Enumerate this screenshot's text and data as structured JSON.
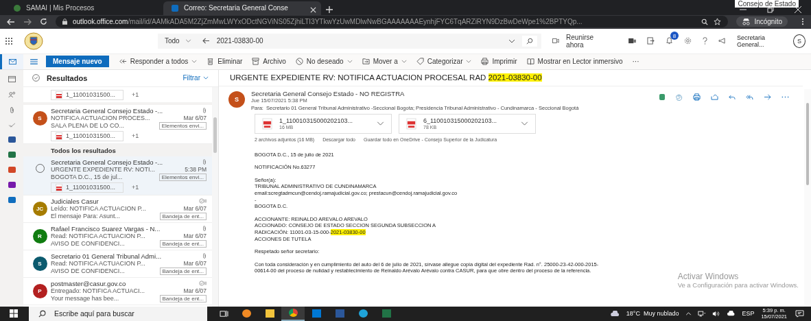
{
  "browser": {
    "overlay_text": "Consejo de Estado",
    "tabs": [
      {
        "title": "SAMAI | Mis Procesos",
        "selected": false
      },
      {
        "title": "Correo: Secretaria General Conse",
        "selected": true
      }
    ],
    "url_host": "outlook.office.com",
    "url_path": "/mail/id/AAMkADA5M2ZjZmMwLWYxODctNGViNS05ZjhiLTI3YTkwYzUwMDlwNwBGAAAAAAAEynhjFYC6TqARZiRYN9DzBwDeWpe1%2BPTYQp...",
    "incognito": "Incógnito"
  },
  "header": {
    "scope": "Todo",
    "search": "2021-03830-00",
    "meet": "Reunirse ahora",
    "badge": "8",
    "account": "Secretaria General...",
    "avatar": "S"
  },
  "commands": [
    {
      "label": "Mensaje nuevo",
      "kind": "primary"
    },
    {
      "label": "Responder a todos",
      "kind": "reply-all"
    },
    {
      "label": "Eliminar",
      "kind": "delete"
    },
    {
      "label": "Archivo",
      "kind": "archive"
    },
    {
      "label": "No deseado",
      "kind": "junk"
    },
    {
      "label": "Mover a",
      "kind": "move"
    },
    {
      "label": "Categorizar",
      "kind": "tag"
    },
    {
      "label": "Imprimir",
      "kind": "print"
    },
    {
      "label": "Mostrar en Lector inmersivo",
      "kind": "reader"
    },
    {
      "label": "···",
      "kind": "more"
    }
  ],
  "list": {
    "title": "Resultados",
    "filter": "Filtrar",
    "items": [
      {
        "kind": "attachment-row",
        "attachment": "1_11001031500...",
        "extra": "+1"
      },
      {
        "kind": "message",
        "selected": false,
        "initials": "S",
        "color": "#c4501a",
        "sender": "Secretaria General Consejo Estado -...",
        "has_attachment": true,
        "subject": "NOTIFICA ACTUACION PROCES...",
        "time": "Mar 6/07",
        "preview": "SALA PLENA DE LO CO...",
        "folder": "Elementos envi...",
        "attachment": "1_11001031500...",
        "extra": "+1"
      },
      {
        "kind": "section",
        "label": "Todos los resultados"
      },
      {
        "kind": "message",
        "selected": true,
        "sender": "Secretaria General Consejo Estado -...",
        "has_attachment": true,
        "subject": "URGENTE EXPEDIENTE RV: NOTI...",
        "time": "5:38 PM",
        "preview": "BOGOTA D.C., 15 de jul...",
        "folder": "Elementos envi...",
        "attachment": "1_11001031500...",
        "extra": "+1"
      },
      {
        "kind": "message",
        "selected": false,
        "initials": "JC",
        "color": "#a67c00",
        "sender": "Judiciales Casur",
        "has_attachment": false,
        "subject": "Leído: NOTIFICA ACTUACION P...",
        "time": "Mar 6/07",
        "preview": "El mensaje Para: Asunt...",
        "folder": "Bandeja de ent..."
      },
      {
        "kind": "message",
        "selected": false,
        "initials": "R",
        "color": "#107c10",
        "sender": "Rafael Francisco Suarez Vargas - N...",
        "has_attachment": true,
        "subject": "Read: NOTIFICA ACTUACION P...",
        "time": "Mar 6/07",
        "preview": "AVISO DE CONFIDENCI...",
        "folder": "Bandeja de ent..."
      },
      {
        "kind": "message",
        "selected": false,
        "initials": "S",
        "color": "#0b5a6e",
        "sender": "Secretario 01 General Tribunal Admi...",
        "has_attachment": true,
        "subject": "Read: NOTIFICA ACTUACION P...",
        "time": "Mar 6/07",
        "preview": "AVISO DE CONFIDENCI...",
        "folder": "Bandeja de ent..."
      },
      {
        "kind": "message",
        "selected": false,
        "initials": "P",
        "color": "#b32020",
        "sender": "postmaster@casur.gov.co",
        "has_attachment": false,
        "subject": "Entregado: NOTIFICA ACTUACI...",
        "time": "Mar 6/07",
        "preview": "Your message has bee...",
        "folder": "Bandeja de ent..."
      }
    ]
  },
  "reading": {
    "subject": [
      {
        "text": "URGENTE EXPEDIENTE RV: NOTIFICA ACTUACION PROCESAL RAD ",
        "highlighted": false
      },
      {
        "text": "2021-03830-00",
        "highlighted": true
      }
    ],
    "sender_initial": "S",
    "sender": "Secretaria General Consejo Estado - NO REGISTRA",
    "date": "Jue 15/07/2021 5:38 PM",
    "to_label": "Para:",
    "to": "Secretario 01 General Tribunal Administrativo -Seccional Bogota; Presidencia Tribunal Administrativo - Cundinamarca - Seccional Bogotá",
    "attachments": [
      {
        "name": "1_110010315000202103...",
        "size": "16 MB"
      },
      {
        "name": "6_110010315000202103...",
        "size": "78 KB"
      }
    ],
    "attachment_summary": "2 archivos adjuntos (16 MB)",
    "download_all": "Descargar todo",
    "save_all": "Guardar todo en OneDrive - Consejo Superior de la Judicatura",
    "body": [
      [
        [
          {
            "text": "BOGOTA D.C., 15 de julio de 2021",
            "highlighted": false
          }
        ]
      ],
      [
        [
          {
            "text": "NOTIFICACIÓN No.63277",
            "highlighted": false
          }
        ]
      ],
      [
        [
          {
            "text": "Señor(a):",
            "highlighted": false
          }
        ],
        [
          {
            "text": "TRIBUNAL ADMINISTRATIVO DE CUNDINAMARCA",
            "highlighted": false
          }
        ],
        [
          {
            "text": "email:scregtadmcun@cendoj.ramajudicial.gov.co; prestacun@cendoj.ramajudicial.gov.co",
            "highlighted": false
          }
        ],
        [
          {
            "text": "-",
            "highlighted": false
          }
        ],
        [
          {
            "text": "BOGOTA D.C.",
            "highlighted": false
          }
        ]
      ],
      [
        [
          {
            "text": "ACCIONANTE: REINALDO AREVALO AREVALO",
            "highlighted": false
          }
        ],
        [
          {
            "text": "ACCIONADO: CONSEJO DE ESTADO SECCION SEGUNDA SUBSECCION A",
            "highlighted": false
          }
        ],
        [
          {
            "text": "RADICACIÓN: 11001-03-15-000-",
            "highlighted": false
          },
          {
            "text": "2021-03830-00",
            "highlighted": true
          }
        ],
        [
          {
            "text": "ACCIONES DE TUTELA",
            "highlighted": false
          }
        ]
      ],
      [
        [
          {
            "text": "Respetado señor secretario:",
            "highlighted": false
          }
        ]
      ],
      [
        [
          {
            "text": "Con toda consideración y en cumplimiento del auto del 6 de julio de 2021, sírvase allegue copia digital del expediente Rad. n°. 25000-23-42-000-2015-",
            "highlighted": false
          }
        ],
        [
          {
            "text": "00614-00 del proceso de nulidad y restablecimiento de Reinaldo Arévalo Arévalo contra CASUR, para que obre dentro del proceso de la referencia.",
            "highlighted": false
          }
        ]
      ]
    ]
  },
  "activation": {
    "title": "Activar Windows",
    "subtitle": "Ve a Configuración para activar Windows."
  },
  "taskbar": {
    "search": "Escribe aquí para buscar",
    "weather": "18°C  Muy nublado",
    "language": "ESP",
    "time": "5:39 p. m.",
    "date": "15/07/2021"
  }
}
